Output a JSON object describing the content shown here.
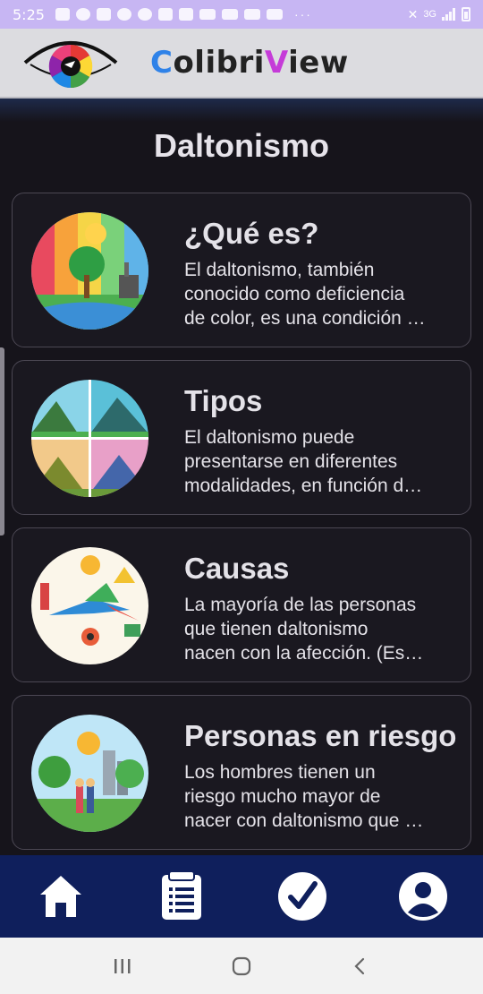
{
  "status_bar": {
    "time": "5:25",
    "more": "···",
    "network": "3G"
  },
  "app": {
    "brand_part1": "C",
    "brand_part2": "olibri",
    "brand_part3": "V",
    "brand_part4": "iew"
  },
  "page": {
    "title": "Daltonismo"
  },
  "cards": [
    {
      "title": "¿Qué es?",
      "lines": [
        "El daltonismo, también",
        "conocido como deficiencia",
        "de color, es una condición …"
      ]
    },
    {
      "title": "Tipos",
      "lines": [
        "El daltonismo puede",
        "presentarse en diferentes",
        "modalidades, en función d…"
      ]
    },
    {
      "title": "Causas",
      "lines": [
        "La mayoría de las personas",
        "que tienen daltonismo",
        "nacen con la afección. (Es…"
      ]
    },
    {
      "title": "Personas en riesgo",
      "lines": [
        "Los hombres tienen un",
        "riesgo mucho mayor de",
        "nacer con daltonismo que …"
      ]
    }
  ],
  "bottom_nav": [
    "home-icon",
    "test-list-icon",
    "check-icon",
    "profile-icon"
  ],
  "colors": {
    "header_bg": "#dcdce0",
    "nav_bg": "#0f1f5c",
    "page_bg": "#16141b",
    "status_bg": "#c7b6f3"
  }
}
